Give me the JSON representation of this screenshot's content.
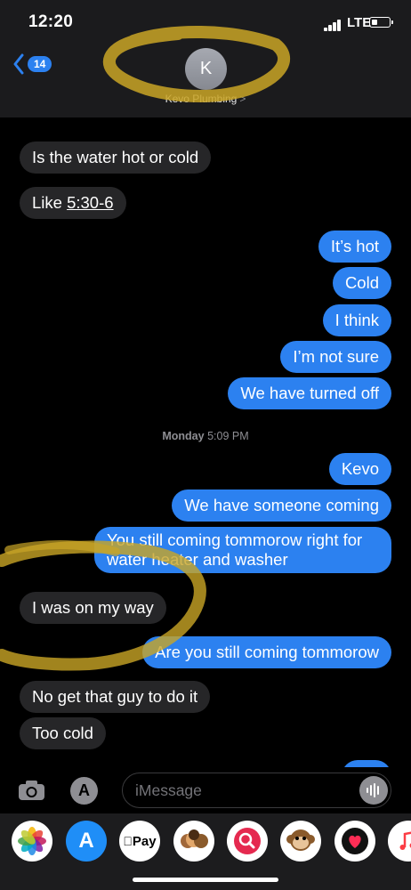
{
  "status_bar": {
    "time": "12:20",
    "network": "LTE"
  },
  "header": {
    "back_count": "14",
    "avatar_initial": "K",
    "contact_name": "Kevo Plumbing",
    "contact_chevron": ">"
  },
  "messages": {
    "m0": "Is the water hot or cold",
    "m1_a": "Like ",
    "m1_b": "5:30-6",
    "m2": "It’s hot",
    "m3": "Cold",
    "m4": "I think",
    "m5": "I’m not sure",
    "m6": "We have turned off",
    "m7": "Kevo",
    "m8": "We have someone coming",
    "m9": "You still coming tommorow right for water heater and washer",
    "m10": "I was on my way",
    "m11": "Are you still coming tommorow",
    "m12": "No get that guy to do it",
    "m13": "Too cold"
  },
  "timestamp": {
    "day": "Monday",
    "time": "5:09 PM"
  },
  "compose": {
    "placeholder": "iMessage"
  },
  "app_drawer": {
    "apps": [
      "photos-app",
      "app-store",
      "apple-pay",
      "memoji",
      "images-search",
      "animoji-monkey",
      "digital-touch",
      "music"
    ],
    "apple_pay_label": "Pay"
  },
  "colors": {
    "outgoing_bubble": "#2c81f0",
    "incoming_bubble": "#262628",
    "header_bg": "#1b1b1d",
    "highlight_marker": "#c9a526"
  }
}
